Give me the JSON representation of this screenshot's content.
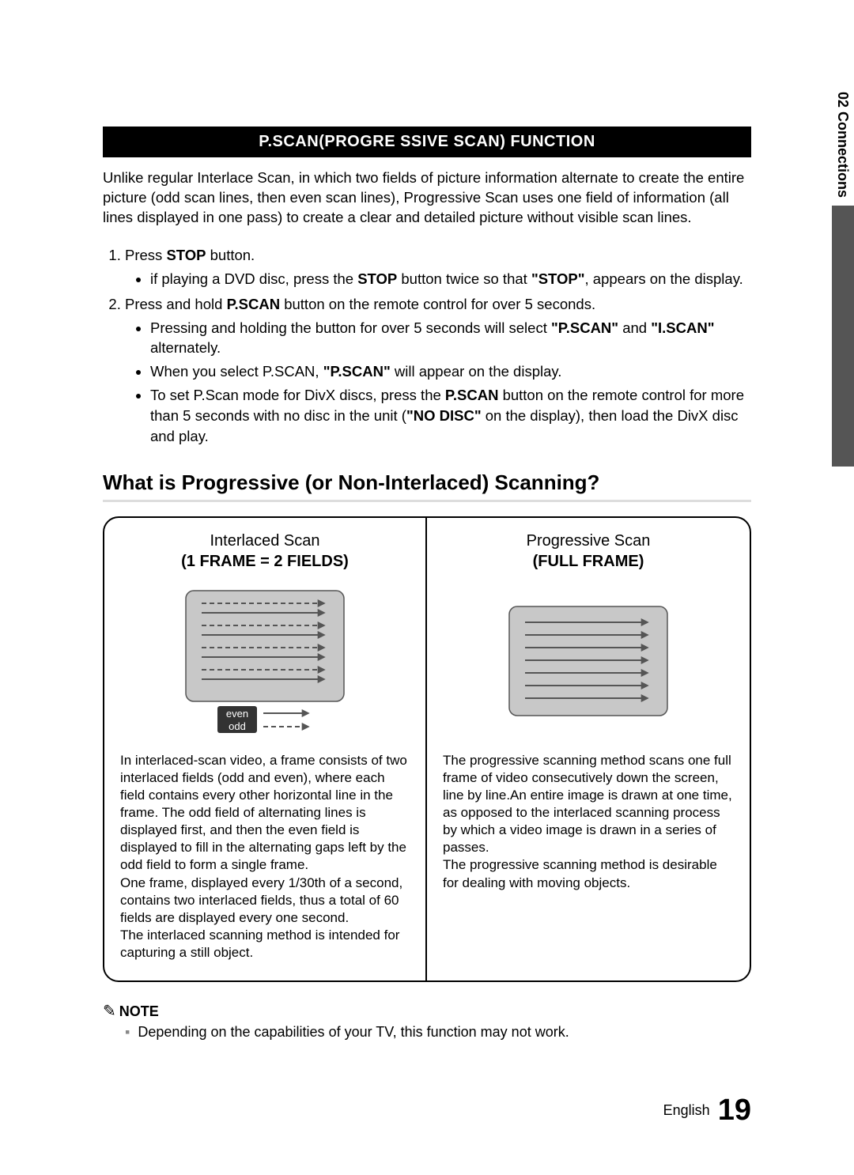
{
  "sideTab": "02  Connections",
  "sectionHeader": "P.SCAN(PROGRE SSIVE SCAN) FUNCTION",
  "intro": "Unlike regular Interlace Scan, in which two fields of picture information alternate to create the entire picture (odd scan lines, then even scan lines), Progressive Scan uses one field of information (all lines displayed in one pass) to create a clear and detailed picture without visible scan lines.",
  "steps": {
    "s1": {
      "text_a": "Press ",
      "text_b": "STOP",
      "text_c": " button.",
      "b1_a": "if playing a DVD disc, press the ",
      "b1_b": "STOP",
      "b1_c": " button twice so that ",
      "b1_d": "\"STOP\"",
      "b1_e": ", appears on the display."
    },
    "s2": {
      "text_a": "Press and hold ",
      "text_b": "P.SCAN",
      "text_c": " button on the remote control for over 5 seconds.",
      "b1_a": "Pressing and holding the button for over 5 seconds will select ",
      "b1_b": "\"P.SCAN\"",
      "b1_c": " and ",
      "b1_d": "\"I.SCAN\"",
      "b1_e": " alternately.",
      "b2_a": "When you select P.SCAN, ",
      "b2_b": "\"P.SCAN\"",
      "b2_c": " will appear on the display.",
      "b3_a": "To set P.Scan mode for DivX discs, press the ",
      "b3_b": "P.SCAN",
      "b3_c": " button on the remote control for more than 5 seconds with no disc in the unit (",
      "b3_d": "\"NO DISC\"",
      "b3_e": " on the display), then load the DivX disc and play."
    }
  },
  "subheading": "What is Progressive (or Non-Interlaced) Scanning?",
  "compare": {
    "left": {
      "title1": "Interlaced Scan",
      "title2": "(1 FRAME = 2 FIELDS)",
      "legend_even": "even",
      "legend_odd": "odd",
      "text": "In interlaced-scan video, a frame consists of two interlaced fields (odd and even), where each field contains every other horizontal line in the frame. The odd field of alternating lines is displayed first, and then the even field is displayed to fill in the alternating gaps left by the odd field to form a single frame.\nOne frame, displayed every 1/30th of a second, contains two interlaced fields, thus a total of 60 fields are displayed every one second.\nThe interlaced scanning method is intended for capturing a still object."
    },
    "right": {
      "title1": "Progressive Scan",
      "title2": "(FULL FRAME)",
      "text": "The progressive scanning method scans one full frame of video consecutively down the screen, line by line.An entire image is drawn at one time, as opposed to the interlaced scanning process by which a video image is drawn in a series of passes.\nThe progressive scanning method is desirable for dealing with moving objects."
    }
  },
  "note": {
    "label": "NOTE",
    "item": "Depending on the capabilities of your TV, this function may not work."
  },
  "footer": {
    "lang": "English",
    "page": "19"
  }
}
